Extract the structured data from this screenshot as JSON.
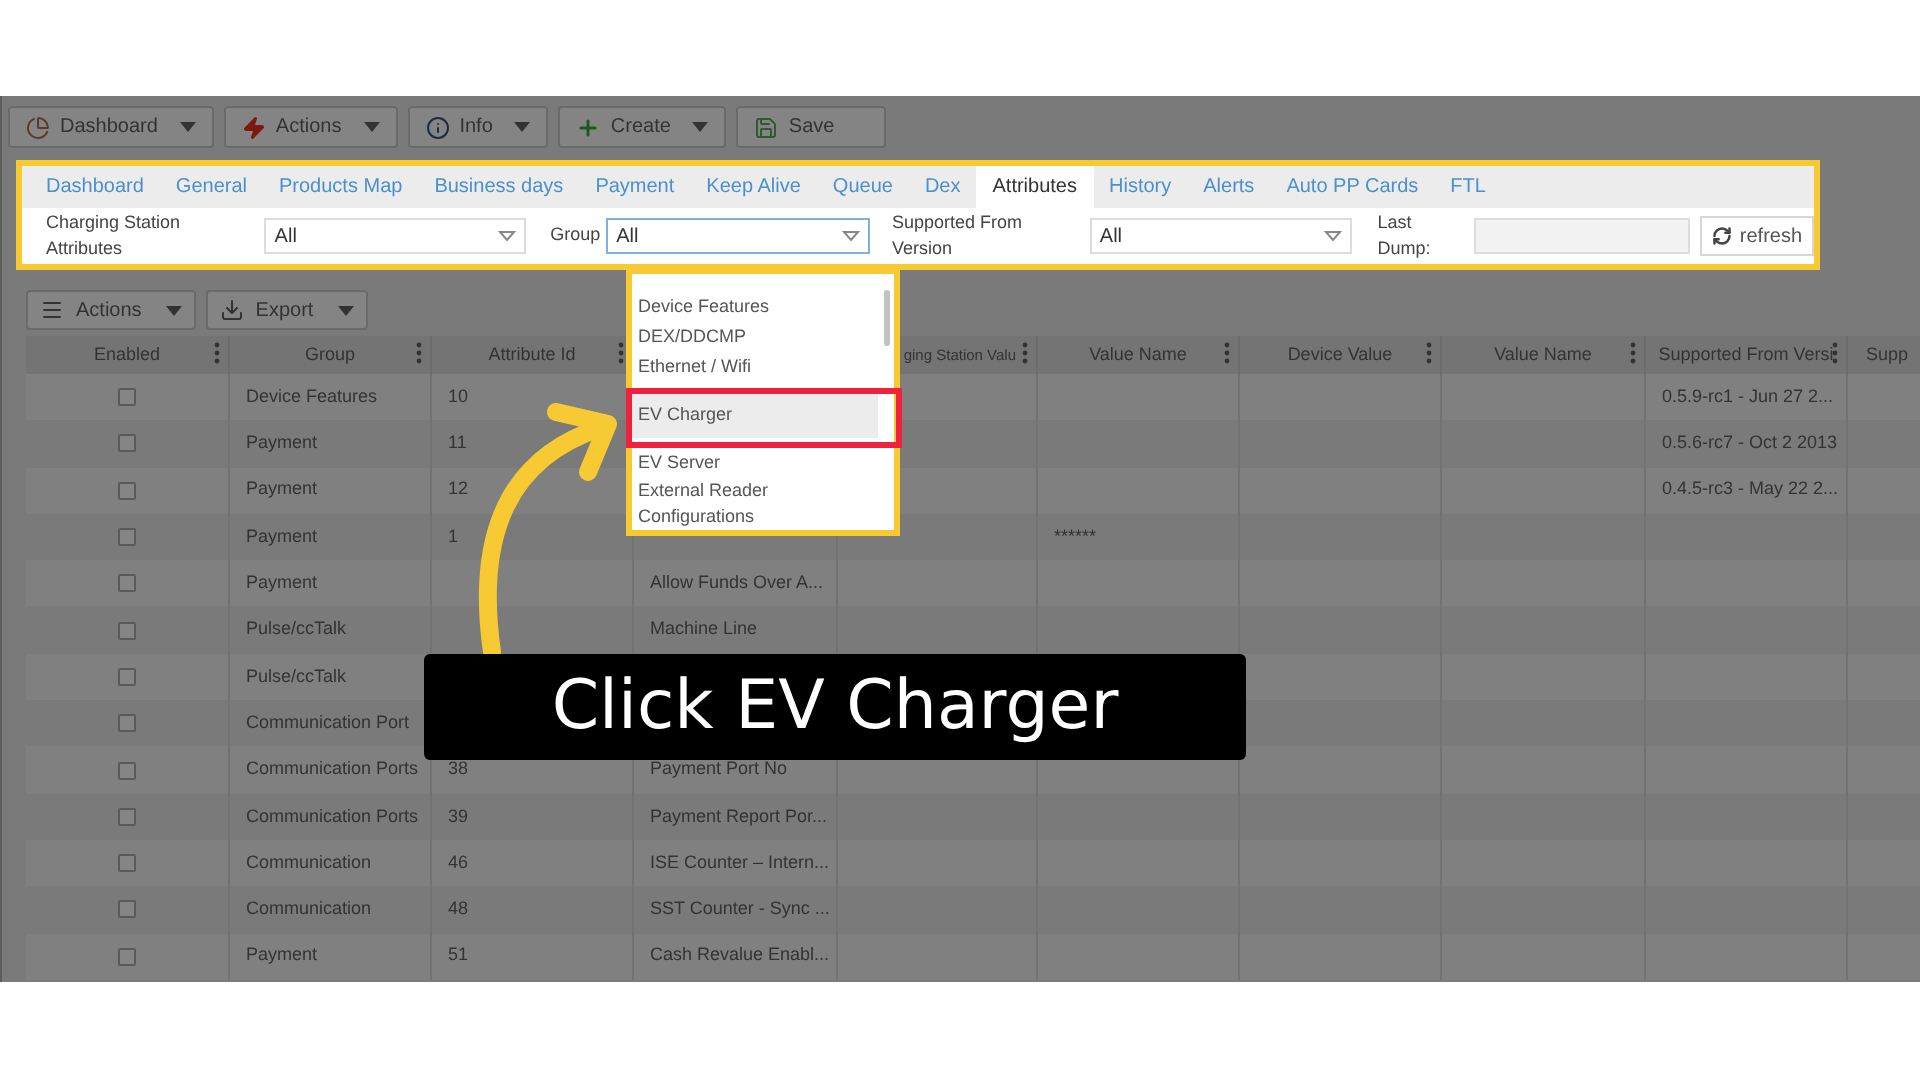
{
  "toolbar": [
    {
      "label": "Dashboard",
      "kind": "menu"
    },
    {
      "label": "Actions",
      "kind": "menu"
    },
    {
      "label": "Info",
      "kind": "menu"
    },
    {
      "label": "Create",
      "kind": "menu"
    },
    {
      "label": "Save",
      "kind": "plain"
    }
  ],
  "tabs": [
    {
      "label": "Dashboard",
      "selected": false
    },
    {
      "label": "General",
      "selected": false
    },
    {
      "label": "Products Map",
      "selected": false
    },
    {
      "label": "Business days",
      "selected": false
    },
    {
      "label": "Payment",
      "selected": false
    },
    {
      "label": "Keep Alive",
      "selected": false
    },
    {
      "label": "Queue",
      "selected": false
    },
    {
      "label": "Dex",
      "selected": false
    },
    {
      "label": "Attributes",
      "selected": true
    },
    {
      "label": "History",
      "selected": false
    },
    {
      "label": "Alerts",
      "selected": false
    },
    {
      "label": "Auto PP Cards",
      "selected": false
    },
    {
      "label": "FTL",
      "selected": false
    }
  ],
  "filters": {
    "charging_station_attributes": {
      "label": "Charging Station Attributes",
      "value": "All"
    },
    "group": {
      "label": "Group",
      "value": "All"
    },
    "supported_from_version": {
      "label": "Supported From Version",
      "value": "All"
    },
    "last_dump": {
      "label": "Last Dump:"
    },
    "refresh_button": "refresh"
  },
  "group_dropdown": {
    "items": [
      {
        "label": "Device Features",
        "selected": false
      },
      {
        "label": "DEX/DDCMP",
        "selected": false
      },
      {
        "label": "Ethernet / Wifi",
        "selected": false
      },
      {
        "label": "EV Charger",
        "selected": true
      },
      {
        "label": "EV Server",
        "selected": false
      },
      {
        "label": "External Reader Configurations",
        "selected": false
      }
    ]
  },
  "grid_toolbar": [
    {
      "label": "Actions"
    },
    {
      "label": "Export"
    }
  ],
  "table": {
    "columns": [
      {
        "label": "Enabled"
      },
      {
        "label": "Group"
      },
      {
        "label": "Attribute Id"
      },
      {},
      {
        "label": "ging Station Valu"
      },
      {
        "label": "Value Name"
      },
      {
        "label": "Device Value"
      },
      {
        "label": "Value Name"
      },
      {
        "label": "Supported From Versi"
      },
      {
        "label": "Supp"
      }
    ],
    "rows": [
      {
        "cells": [
          {
            "checked": false
          },
          "Device Features",
          "10",
          null,
          null,
          null,
          null,
          null,
          "0.5.9-rc1 - Jun 27 2...",
          null
        ]
      },
      {
        "cells": [
          {
            "checked": false
          },
          "Payment",
          "11",
          null,
          null,
          null,
          null,
          null,
          "0.5.6-rc7 - Oct 2 2013",
          null
        ]
      },
      {
        "cells": [
          {
            "checked": false
          },
          "Payment",
          "12",
          null,
          null,
          null,
          null,
          null,
          "0.4.5-rc3 - May 22 2...",
          null
        ]
      },
      {
        "cells": [
          {
            "checked": false
          },
          "Payment",
          "1",
          null,
          null,
          "******",
          null,
          null,
          null,
          null
        ]
      },
      {
        "cells": [
          {
            "checked": false
          },
          "Payment",
          null,
          "Allow Funds Over A...",
          null,
          null,
          null,
          null,
          null,
          null
        ]
      },
      {
        "cells": [
          {
            "checked": false
          },
          "Pulse/ccTalk",
          null,
          "Machine Line",
          null,
          null,
          null,
          null,
          null,
          null
        ]
      },
      {
        "cells": [
          {
            "checked": false
          },
          "Pulse/ccTalk",
          null,
          null,
          null,
          null,
          null,
          null,
          null,
          null
        ]
      },
      {
        "cells": [
          {
            "checked": false
          },
          "Communication Port",
          null,
          null,
          null,
          null,
          null,
          null,
          null,
          null
        ]
      },
      {
        "cells": [
          {
            "checked": false
          },
          "Communication Ports",
          "38",
          "Payment Port No",
          null,
          null,
          null,
          null,
          null,
          null
        ]
      },
      {
        "cells": [
          {
            "checked": false
          },
          "Communication Ports",
          "39",
          "Payment Report Por...",
          null,
          null,
          null,
          null,
          null,
          null
        ]
      },
      {
        "cells": [
          {
            "checked": false
          },
          "Communication",
          "46",
          "ISE Counter – Intern...",
          null,
          null,
          null,
          null,
          null,
          null
        ]
      },
      {
        "cells": [
          {
            "checked": false
          },
          "Communication",
          "48",
          "SST Counter - Sync ...",
          null,
          null,
          null,
          null,
          null,
          null
        ]
      },
      {
        "cells": [
          {
            "checked": false
          },
          "Payment",
          "51",
          "Cash Revalue Enabl...",
          null,
          null,
          null,
          null,
          null,
          null
        ]
      }
    ]
  },
  "callout": {
    "text": "Click EV Charger"
  }
}
